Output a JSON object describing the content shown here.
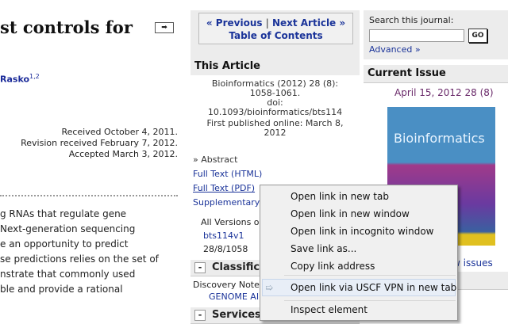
{
  "article": {
    "title": "st controls for",
    "author": "Rasko",
    "author_sup": "1,2",
    "received": "Received October 4, 2011.",
    "revised": "Revision received February 7, 2012.",
    "accepted": "Accepted March 3, 2012.",
    "abstract_lines": [
      "g RNAs that regulate gene",
      "Next-generation sequencing",
      "e an opportunity to predict",
      "se predictions relies on the set of",
      "nstrate that commonly used",
      "ble and provide a rational"
    ],
    "arrow": "➡"
  },
  "nav": {
    "previous": "« Previous",
    "sep": "|",
    "next": "Next Article »",
    "toc": "Table of Contents"
  },
  "this_article": {
    "header": "This Article",
    "citation": "Bioinformatics (2012) 28 (8): 1058-1061.",
    "doi_label": "doi:",
    "doi": "10.1093/bioinformatics/bts114",
    "published": "First published online: March 8, 2012",
    "abstract": "» Abstract",
    "full_html": "Full Text (HTML)",
    "full_pdf": "Full Text (PDF)",
    "supplementary": "Supplementary",
    "versions": "All Versions o",
    "version_id": "bts114v1",
    "version_ref": "28/8/1058"
  },
  "classification": {
    "header": "Classifica",
    "minus": "-",
    "note": "Discovery Note",
    "category": "GENOME AI"
  },
  "services": {
    "header": "Services",
    "minus": "-"
  },
  "search": {
    "label": "Search this journal:",
    "value": "",
    "go": "GO",
    "advanced": "Advanced »"
  },
  "current_issue": {
    "header": "Current Issue",
    "date": "April 15, 2012 28 (8)",
    "cover_title": "Bioinformatics",
    "view_issues": "w issues"
  },
  "context_menu": {
    "items": [
      "Open link in new tab",
      "Open link in new window",
      "Open link in incognito window",
      "Save link as...",
      "Copy link address",
      "Open link via USCF VPN in new tab",
      "Inspect element"
    ]
  }
}
